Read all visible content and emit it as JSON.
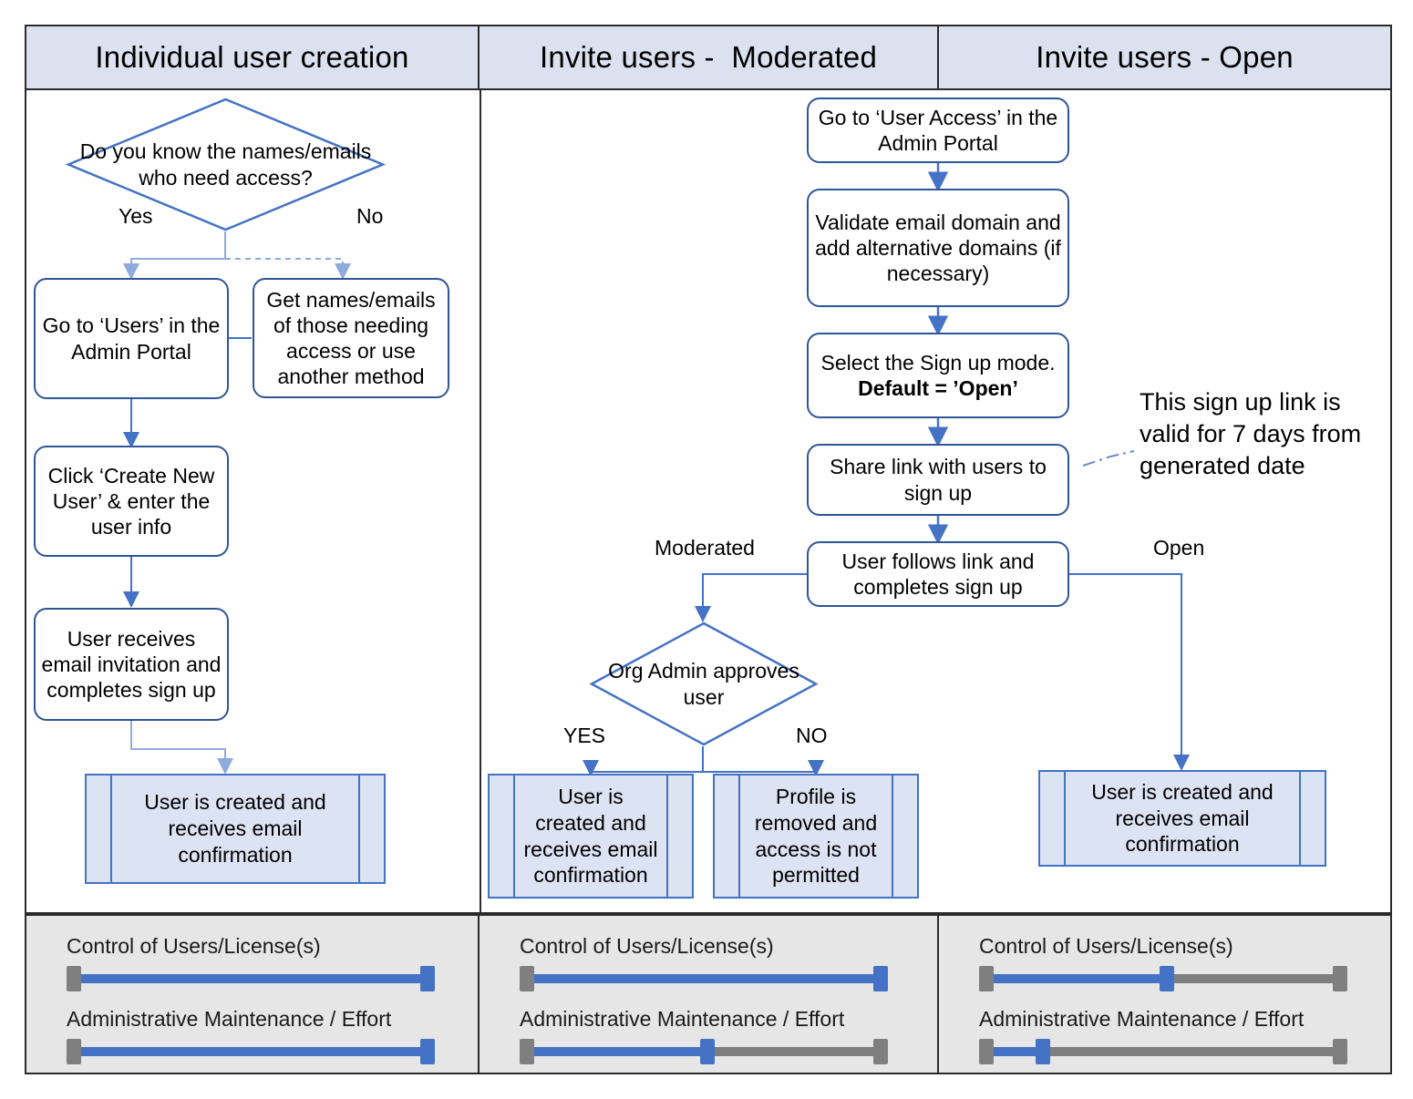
{
  "headers": [
    {
      "label": "Individual user creation"
    },
    {
      "label": "Invite users -  Moderated"
    },
    {
      "label": "Invite users - Open"
    }
  ],
  "col1": {
    "decision": "Do you know the names/emails who need access?",
    "yes_label": "Yes",
    "no_label": "No",
    "node_goto_users": "Go to ‘Users’ in the Admin Portal",
    "node_get_names": "Get names/emails of those needing access or use another method",
    "node_create_user": "Click ‘Create New User’  & enter the user info",
    "node_user_receives": "User receives email invitation and completes sign up",
    "terminal": "User is created and receives email confirmation"
  },
  "col23": {
    "node_user_access": "Go to ‘User Access’ in the Admin Portal",
    "node_validate": "Validate email domain and add alternative domains (if necessary)",
    "node_signup_mode_line1": "Select the Sign up mode.",
    "node_signup_mode_line2": "Default = ’Open’",
    "node_share_link": "Share link with users to sign up",
    "node_follows_link": "User follows link and completes sign up",
    "branch_moderated": "Moderated",
    "branch_open": "Open",
    "decision_approve": "Org Admin approves user",
    "yes_label": "YES",
    "no_label": "NO",
    "terminal_yes": "User  is created and receives email confirmation",
    "terminal_no": "Profile is removed and access is not permitted",
    "terminal_open": "User is created and receives email confirmation",
    "callout": "This sign up link is valid for 7 days from generated date"
  },
  "sliders": {
    "control_label": "Control of Users/License(s)",
    "admin_label": "Administrative Maintenance / Effort",
    "columns": [
      {
        "control_value": 100,
        "admin_value": 100
      },
      {
        "control_value": 100,
        "admin_value": 51
      },
      {
        "control_value": 51,
        "admin_value": 16
      }
    ]
  },
  "colors": {
    "header_fill": "#dce1f0",
    "node_border": "#2f5597",
    "terminal_fill": "#dce3f2",
    "terminal_border": "#4472c4",
    "connector": "#4472c4",
    "slider_fill": "#4472c4",
    "slider_track": "#7f7f7f",
    "footer_bg": "#e6e6e6"
  }
}
